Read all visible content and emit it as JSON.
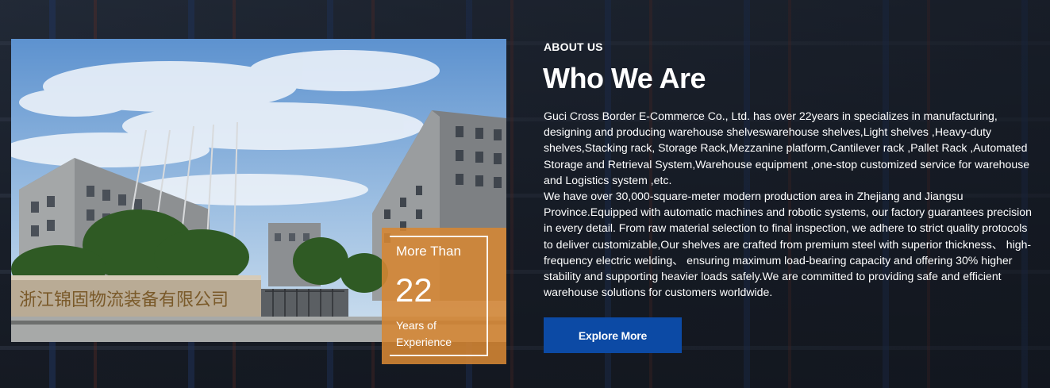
{
  "about": {
    "eyebrow": "ABOUT US",
    "heading": "Who We Are",
    "paragraphs": [
      "Guci Cross Border E-Commerce Co., Ltd. has over 22years in specializes in manufacturing, designing and producing warehouse shelveswarehouse shelves,Light shelves ,Heavy-duty shelves,Stacking rack, Storage Rack,Mezzanine platform,Cantilever rack ,Pallet Rack ,Automated Storage and Retrieval System,Warehouse equipment ,one-stop customized service for warehouse and Logistics system ,etc.",
      "We have over 30,000-square-meter modern production area in Zhejiang and Jiangsu Province.Equipped with automatic machines and robotic systems, our factory guarantees precision in every detail. From raw material selection to final inspection, we adhere to strict quality protocols to deliver customizable,Our shelves are crafted from premium steel with superior thickness、 high-frequency electric welding、 ensuring maximum load-bearing capacity and offering 30% higher stability and supporting heavier loads safely.We are committed to providing safe and efficient warehouse solutions for customers worldwide."
    ],
    "cta_label": "Explore More"
  },
  "badge": {
    "prefix": "More Than",
    "number": "22",
    "suffix": "Years of Experience"
  },
  "photo": {
    "sign_text": "浙江锦固物流装备有限公司"
  },
  "colors": {
    "accent_blue": "#0c4aa5",
    "badge_orange": "#d68633"
  }
}
